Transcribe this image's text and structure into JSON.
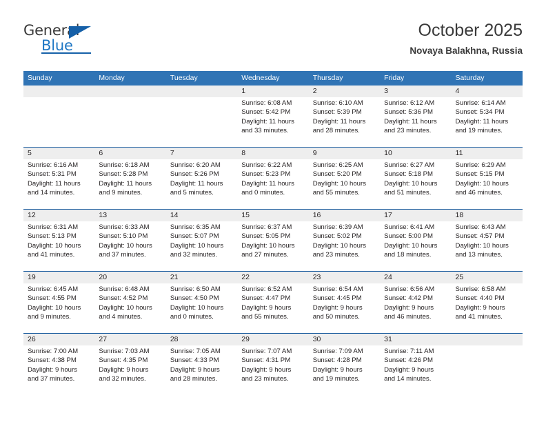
{
  "logo": {
    "word_one": "General",
    "word_two": "Blue",
    "icon": "triangle-flag-icon"
  },
  "header": {
    "title": "October 2025",
    "location": "Novaya Balakhna, Russia"
  },
  "weekdays": [
    "Sunday",
    "Monday",
    "Tuesday",
    "Wednesday",
    "Thursday",
    "Friday",
    "Saturday"
  ],
  "colors": {
    "header_blue": "#3074b5",
    "divider_blue": "#1f5fa0",
    "date_band": "#eeeeee",
    "logo_blue": "#1f77c4",
    "text": "#231f20"
  },
  "labels": {
    "sunrise_prefix": "Sunrise:",
    "sunset_prefix": "Sunset:",
    "daylight_prefix": "Daylight:"
  },
  "weeks": [
    [
      {
        "day": "",
        "sunrise": "",
        "sunset": "",
        "daylight_line1": "",
        "daylight_line2": ""
      },
      {
        "day": "",
        "sunrise": "",
        "sunset": "",
        "daylight_line1": "",
        "daylight_line2": ""
      },
      {
        "day": "",
        "sunrise": "",
        "sunset": "",
        "daylight_line1": "",
        "daylight_line2": ""
      },
      {
        "day": "1",
        "sunrise": "Sunrise: 6:08 AM",
        "sunset": "Sunset: 5:42 PM",
        "daylight_line1": "Daylight: 11 hours",
        "daylight_line2": "and 33 minutes."
      },
      {
        "day": "2",
        "sunrise": "Sunrise: 6:10 AM",
        "sunset": "Sunset: 5:39 PM",
        "daylight_line1": "Daylight: 11 hours",
        "daylight_line2": "and 28 minutes."
      },
      {
        "day": "3",
        "sunrise": "Sunrise: 6:12 AM",
        "sunset": "Sunset: 5:36 PM",
        "daylight_line1": "Daylight: 11 hours",
        "daylight_line2": "and 23 minutes."
      },
      {
        "day": "4",
        "sunrise": "Sunrise: 6:14 AM",
        "sunset": "Sunset: 5:34 PM",
        "daylight_line1": "Daylight: 11 hours",
        "daylight_line2": "and 19 minutes."
      }
    ],
    [
      {
        "day": "5",
        "sunrise": "Sunrise: 6:16 AM",
        "sunset": "Sunset: 5:31 PM",
        "daylight_line1": "Daylight: 11 hours",
        "daylight_line2": "and 14 minutes."
      },
      {
        "day": "6",
        "sunrise": "Sunrise: 6:18 AM",
        "sunset": "Sunset: 5:28 PM",
        "daylight_line1": "Daylight: 11 hours",
        "daylight_line2": "and 9 minutes."
      },
      {
        "day": "7",
        "sunrise": "Sunrise: 6:20 AM",
        "sunset": "Sunset: 5:26 PM",
        "daylight_line1": "Daylight: 11 hours",
        "daylight_line2": "and 5 minutes."
      },
      {
        "day": "8",
        "sunrise": "Sunrise: 6:22 AM",
        "sunset": "Sunset: 5:23 PM",
        "daylight_line1": "Daylight: 11 hours",
        "daylight_line2": "and 0 minutes."
      },
      {
        "day": "9",
        "sunrise": "Sunrise: 6:25 AM",
        "sunset": "Sunset: 5:20 PM",
        "daylight_line1": "Daylight: 10 hours",
        "daylight_line2": "and 55 minutes."
      },
      {
        "day": "10",
        "sunrise": "Sunrise: 6:27 AM",
        "sunset": "Sunset: 5:18 PM",
        "daylight_line1": "Daylight: 10 hours",
        "daylight_line2": "and 51 minutes."
      },
      {
        "day": "11",
        "sunrise": "Sunrise: 6:29 AM",
        "sunset": "Sunset: 5:15 PM",
        "daylight_line1": "Daylight: 10 hours",
        "daylight_line2": "and 46 minutes."
      }
    ],
    [
      {
        "day": "12",
        "sunrise": "Sunrise: 6:31 AM",
        "sunset": "Sunset: 5:13 PM",
        "daylight_line1": "Daylight: 10 hours",
        "daylight_line2": "and 41 minutes."
      },
      {
        "day": "13",
        "sunrise": "Sunrise: 6:33 AM",
        "sunset": "Sunset: 5:10 PM",
        "daylight_line1": "Daylight: 10 hours",
        "daylight_line2": "and 37 minutes."
      },
      {
        "day": "14",
        "sunrise": "Sunrise: 6:35 AM",
        "sunset": "Sunset: 5:07 PM",
        "daylight_line1": "Daylight: 10 hours",
        "daylight_line2": "and 32 minutes."
      },
      {
        "day": "15",
        "sunrise": "Sunrise: 6:37 AM",
        "sunset": "Sunset: 5:05 PM",
        "daylight_line1": "Daylight: 10 hours",
        "daylight_line2": "and 27 minutes."
      },
      {
        "day": "16",
        "sunrise": "Sunrise: 6:39 AM",
        "sunset": "Sunset: 5:02 PM",
        "daylight_line1": "Daylight: 10 hours",
        "daylight_line2": "and 23 minutes."
      },
      {
        "day": "17",
        "sunrise": "Sunrise: 6:41 AM",
        "sunset": "Sunset: 5:00 PM",
        "daylight_line1": "Daylight: 10 hours",
        "daylight_line2": "and 18 minutes."
      },
      {
        "day": "18",
        "sunrise": "Sunrise: 6:43 AM",
        "sunset": "Sunset: 4:57 PM",
        "daylight_line1": "Daylight: 10 hours",
        "daylight_line2": "and 13 minutes."
      }
    ],
    [
      {
        "day": "19",
        "sunrise": "Sunrise: 6:45 AM",
        "sunset": "Sunset: 4:55 PM",
        "daylight_line1": "Daylight: 10 hours",
        "daylight_line2": "and 9 minutes."
      },
      {
        "day": "20",
        "sunrise": "Sunrise: 6:48 AM",
        "sunset": "Sunset: 4:52 PM",
        "daylight_line1": "Daylight: 10 hours",
        "daylight_line2": "and 4 minutes."
      },
      {
        "day": "21",
        "sunrise": "Sunrise: 6:50 AM",
        "sunset": "Sunset: 4:50 PM",
        "daylight_line1": "Daylight: 10 hours",
        "daylight_line2": "and 0 minutes."
      },
      {
        "day": "22",
        "sunrise": "Sunrise: 6:52 AM",
        "sunset": "Sunset: 4:47 PM",
        "daylight_line1": "Daylight: 9 hours",
        "daylight_line2": "and 55 minutes."
      },
      {
        "day": "23",
        "sunrise": "Sunrise: 6:54 AM",
        "sunset": "Sunset: 4:45 PM",
        "daylight_line1": "Daylight: 9 hours",
        "daylight_line2": "and 50 minutes."
      },
      {
        "day": "24",
        "sunrise": "Sunrise: 6:56 AM",
        "sunset": "Sunset: 4:42 PM",
        "daylight_line1": "Daylight: 9 hours",
        "daylight_line2": "and 46 minutes."
      },
      {
        "day": "25",
        "sunrise": "Sunrise: 6:58 AM",
        "sunset": "Sunset: 4:40 PM",
        "daylight_line1": "Daylight: 9 hours",
        "daylight_line2": "and 41 minutes."
      }
    ],
    [
      {
        "day": "26",
        "sunrise": "Sunrise: 7:00 AM",
        "sunset": "Sunset: 4:38 PM",
        "daylight_line1": "Daylight: 9 hours",
        "daylight_line2": "and 37 minutes."
      },
      {
        "day": "27",
        "sunrise": "Sunrise: 7:03 AM",
        "sunset": "Sunset: 4:35 PM",
        "daylight_line1": "Daylight: 9 hours",
        "daylight_line2": "and 32 minutes."
      },
      {
        "day": "28",
        "sunrise": "Sunrise: 7:05 AM",
        "sunset": "Sunset: 4:33 PM",
        "daylight_line1": "Daylight: 9 hours",
        "daylight_line2": "and 28 minutes."
      },
      {
        "day": "29",
        "sunrise": "Sunrise: 7:07 AM",
        "sunset": "Sunset: 4:31 PM",
        "daylight_line1": "Daylight: 9 hours",
        "daylight_line2": "and 23 minutes."
      },
      {
        "day": "30",
        "sunrise": "Sunrise: 7:09 AM",
        "sunset": "Sunset: 4:28 PM",
        "daylight_line1": "Daylight: 9 hours",
        "daylight_line2": "and 19 minutes."
      },
      {
        "day": "31",
        "sunrise": "Sunrise: 7:11 AM",
        "sunset": "Sunset: 4:26 PM",
        "daylight_line1": "Daylight: 9 hours",
        "daylight_line2": "and 14 minutes."
      },
      {
        "day": "",
        "sunrise": "",
        "sunset": "",
        "daylight_line1": "",
        "daylight_line2": ""
      }
    ]
  ]
}
